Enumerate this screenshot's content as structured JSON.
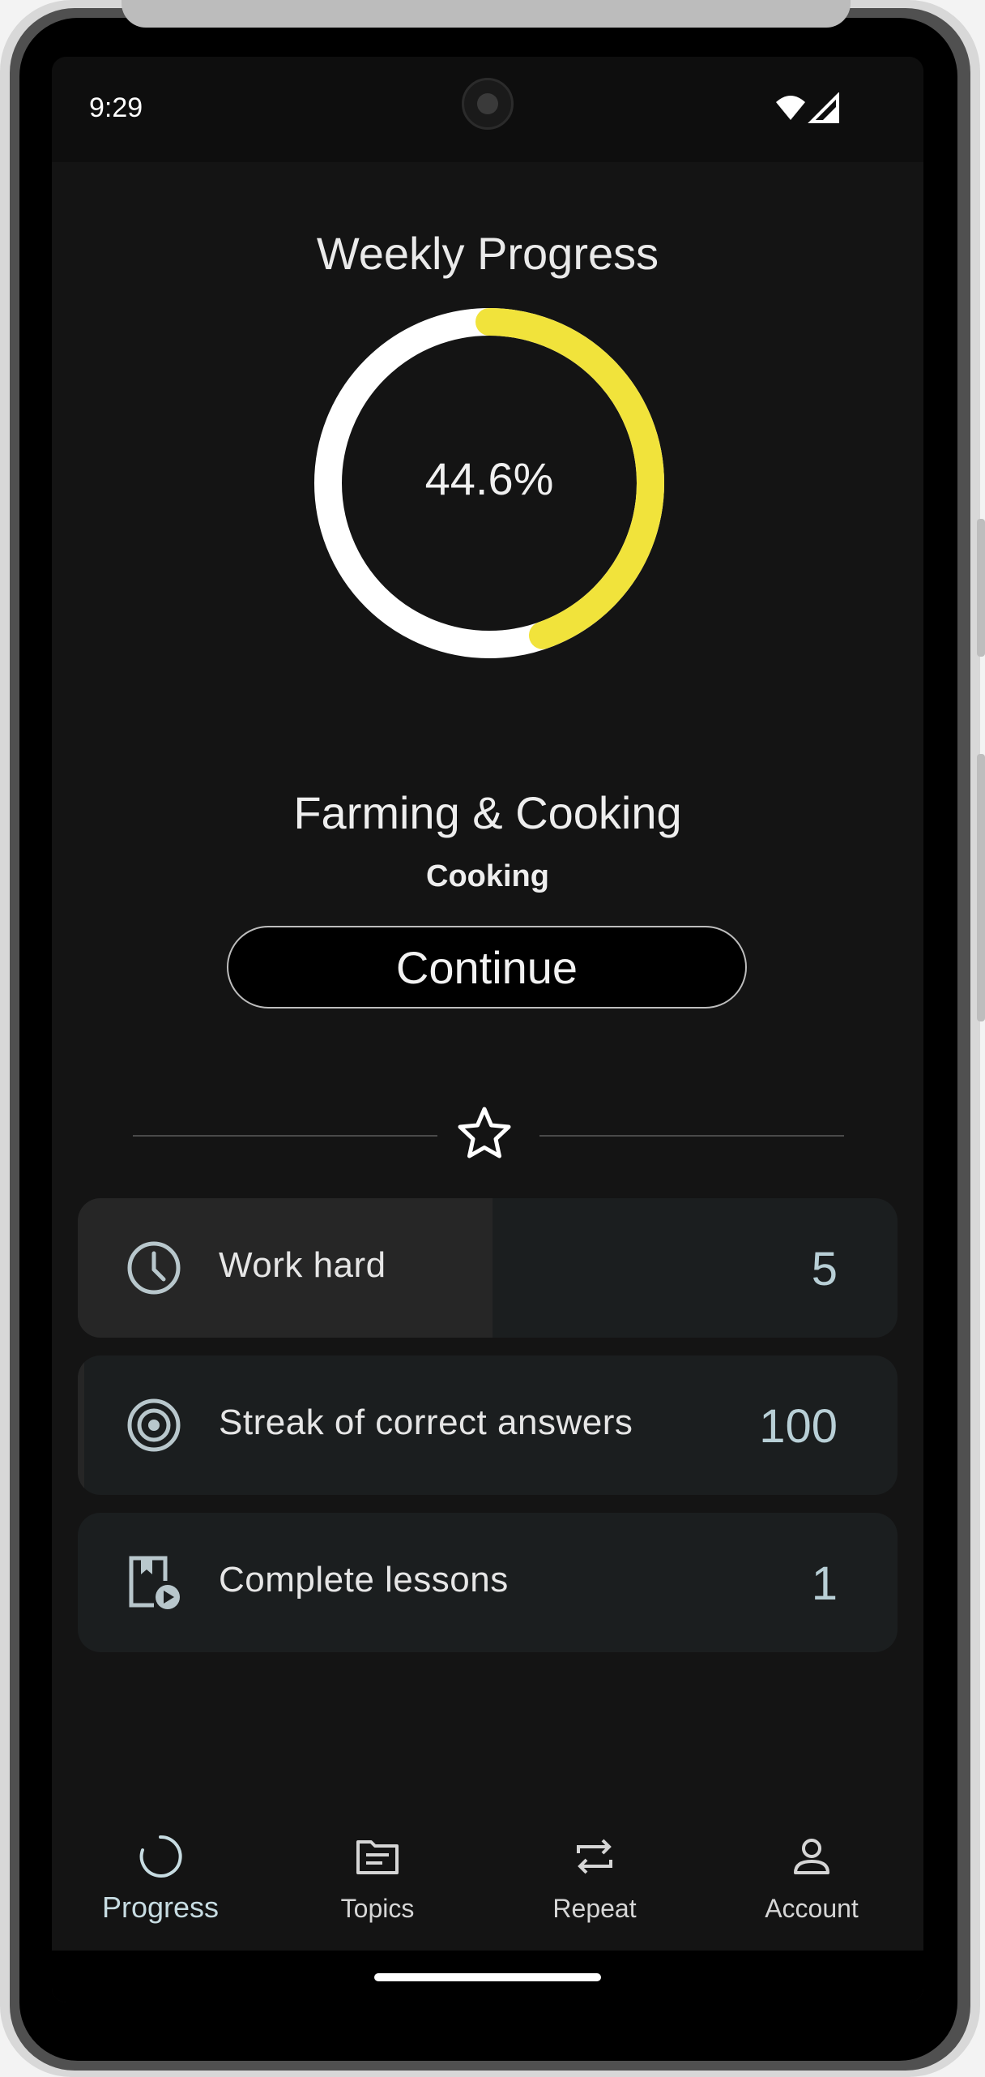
{
  "status_bar": {
    "time": "9:29"
  },
  "progress": {
    "title": "Weekly Progress",
    "percent": 44.6,
    "percent_label": "44.6%",
    "ring_color": "#f1e33b",
    "track_color": "#ffffff"
  },
  "topic": {
    "name": "Farming & Cooking",
    "subtopic": "Cooking",
    "continue_label": "Continue"
  },
  "divider": {
    "icon": "star-icon"
  },
  "goals": [
    {
      "icon": "clock-icon",
      "label": "Work hard",
      "value": "5"
    },
    {
      "icon": "target-icon",
      "label": "Streak of correct answers",
      "value": "100"
    },
    {
      "icon": "lesson-play-icon",
      "label": "Complete lessons",
      "value": "1"
    }
  ],
  "nav": [
    {
      "icon": "progress-icon",
      "label": "Progress",
      "active": true
    },
    {
      "icon": "topics-icon",
      "label": "Topics",
      "active": false
    },
    {
      "icon": "repeat-icon",
      "label": "Repeat",
      "active": false
    },
    {
      "icon": "account-icon",
      "label": "Account",
      "active": false
    }
  ],
  "colors": {
    "background": "#141414",
    "accent": "#f1e33b",
    "value_text": "#b8cfd6"
  }
}
